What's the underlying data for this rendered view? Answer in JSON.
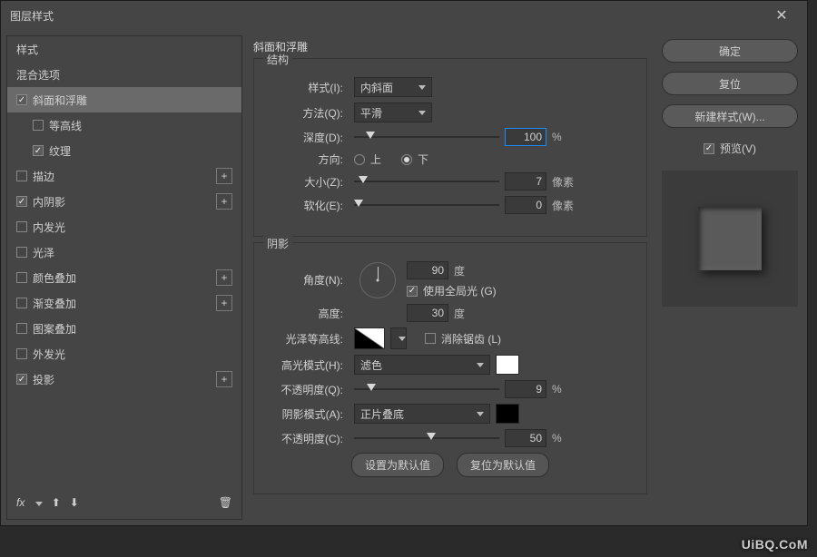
{
  "title": "图层样式",
  "sidebar": {
    "items": [
      {
        "label": "样式",
        "check": null
      },
      {
        "label": "混合选项",
        "check": null
      },
      {
        "label": "斜面和浮雕",
        "check": true,
        "selected": true
      },
      {
        "label": "等高线",
        "check": false,
        "indent": true
      },
      {
        "label": "纹理",
        "check": true,
        "indent": true
      },
      {
        "label": "描边",
        "check": false,
        "plus": true
      },
      {
        "label": "内阴影",
        "check": true,
        "plus": true
      },
      {
        "label": "内发光",
        "check": false
      },
      {
        "label": "光泽",
        "check": false
      },
      {
        "label": "颜色叠加",
        "check": false,
        "plus": true
      },
      {
        "label": "渐变叠加",
        "check": false,
        "plus": true
      },
      {
        "label": "图案叠加",
        "check": false
      },
      {
        "label": "外发光",
        "check": false
      },
      {
        "label": "投影",
        "check": true,
        "plus": true
      }
    ],
    "fx_label": "fx"
  },
  "panel_title": "斜面和浮雕",
  "struct": {
    "legend": "结构",
    "style_label": "样式(I):",
    "style_value": "内斜面",
    "method_label": "方法(Q):",
    "method_value": "平滑",
    "depth_label": "深度(D):",
    "depth_value": "100",
    "depth_unit": "%",
    "dir_label": "方向:",
    "up": "上",
    "down": "下",
    "size_label": "大小(Z):",
    "size_value": "7",
    "size_unit": "像素",
    "soften_label": "软化(E):",
    "soften_value": "0",
    "soften_unit": "像素"
  },
  "shade": {
    "legend": "阴影",
    "angle_label": "角度(N):",
    "angle_value": "90",
    "deg": "度",
    "global_label": "使用全局光 (G)",
    "alt_label": "高度:",
    "alt_value": "30",
    "gloss_label": "光泽等高线:",
    "antialias_label": "消除锯齿 (L)",
    "hmode_label": "高光模式(H):",
    "hmode_value": "滤色",
    "hopacity_label": "不透明度(Q):",
    "hopacity_value": "9",
    "pct": "%",
    "smode_label": "阴影模式(A):",
    "smode_value": "正片叠底",
    "sopacity_label": "不透明度(C):",
    "sopacity_value": "50"
  },
  "defaults": {
    "set": "设置为默认值",
    "reset": "复位为默认值"
  },
  "right": {
    "ok": "确定",
    "cancel": "复位",
    "newstyle": "新建样式(W)...",
    "preview": "预览(V)"
  },
  "watermark": "UiBQ.CoM"
}
